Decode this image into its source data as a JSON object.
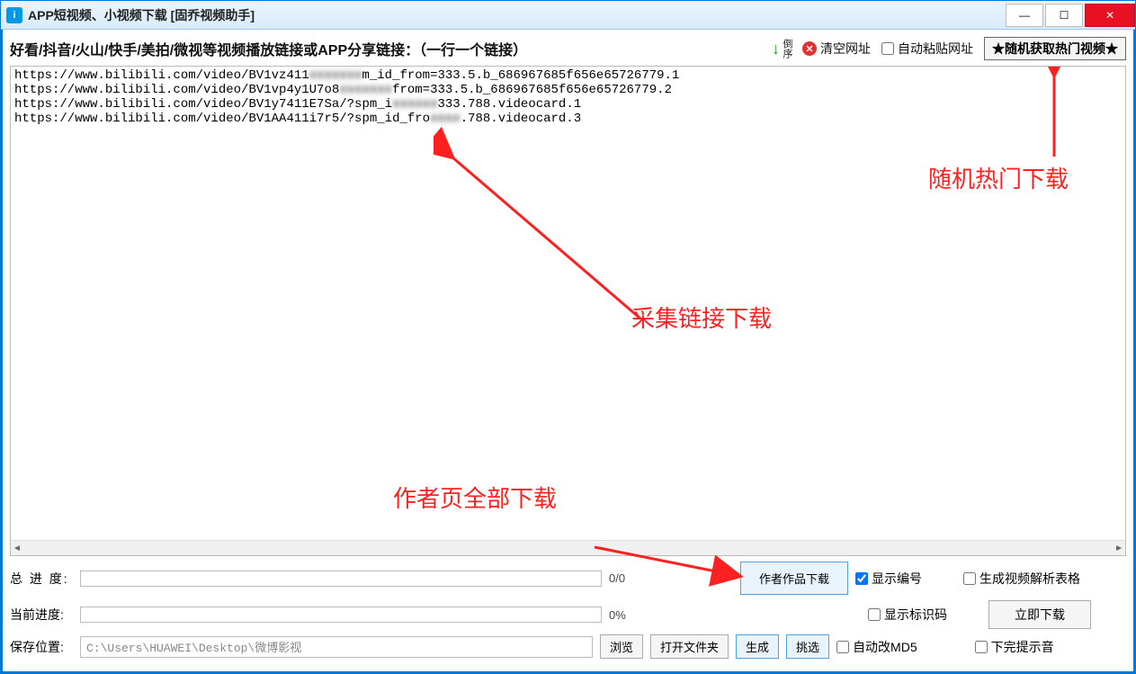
{
  "window": {
    "title": "APP短视频、小视频下载 [固乔视频助手]"
  },
  "toolbar": {
    "instruction": "好看/抖音/火山/快手/美拍/微视等视频播放链接或APP分享链接：（一行一个链接）",
    "reverse_label": "倒序",
    "clear_label": "清空网址",
    "autopaste_label": "自动粘贴网址",
    "random_label": "★随机获取热门视频★"
  },
  "urls": {
    "line1a": "https://www.bilibili.com/video/BV1vz411",
    "line1b": "m_id_from=333.5.b_686967685f656e65726779.1",
    "line2a": "https://www.bilibili.com/video/BV1vp4y1U7o8",
    "line2b": "from=333.5.b_686967685f656e65726779.2",
    "line3a": "https://www.bilibili.com/video/BV1y7411E7Sa/?spm_i",
    "line3b": "333.788.videocard.1",
    "line4a": "https://www.bilibili.com/video/BV1AA411i7r5/?spm_id_fro",
    "line4b": ".788.videocard.3"
  },
  "annotations": {
    "random": "随机热门下载",
    "collect": "采集链接下载",
    "author": "作者页全部下载"
  },
  "bottom": {
    "total_label": "总 进 度:",
    "total_text": "0/0",
    "current_label": "当前进度:",
    "current_text": "0%",
    "save_label": "保存位置:",
    "save_path": "C:\\Users\\HUAWEI\\Desktop\\微博影视",
    "browse": "浏览",
    "openfolder": "打开文件夹",
    "author_works": "作者作品下载",
    "generate": "生成",
    "filter": "挑选",
    "show_number": "显示编号",
    "show_code": "显示标识码",
    "auto_md5": "自动改MD5",
    "gen_table": "生成视频解析表格",
    "download_now": "立即下载",
    "done_sound": "下完提示音"
  }
}
